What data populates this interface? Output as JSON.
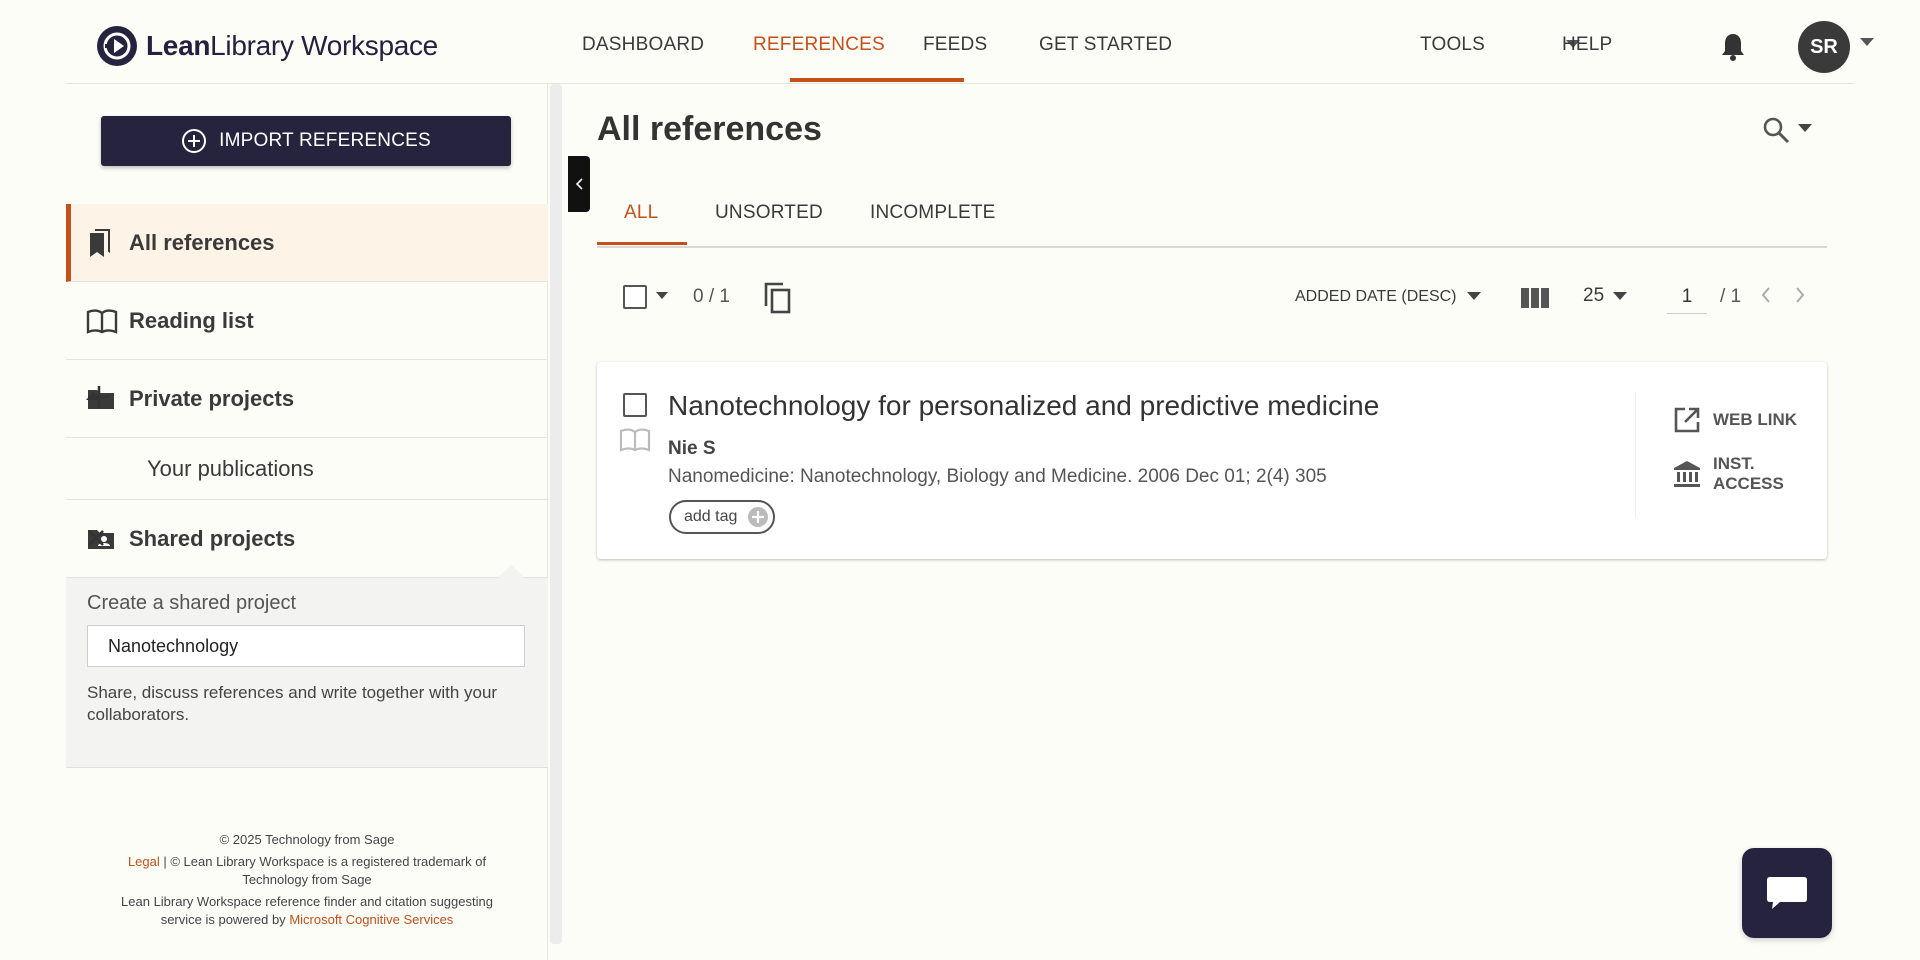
{
  "app": {
    "logo_bold": "Lean",
    "logo_rest": "Library Workspace",
    "brand_color": "#26233f",
    "accent_color": "#c4501a"
  },
  "nav": {
    "items": [
      {
        "label": "DASHBOARD",
        "active": false
      },
      {
        "label": "REFERENCES",
        "active": true
      },
      {
        "label": "FEEDS",
        "active": false
      },
      {
        "label": "GET STARTED",
        "active": false
      }
    ],
    "tools_label": "TOOLS",
    "help_label": "HELP",
    "avatar_initials": "SR"
  },
  "sidebar": {
    "import_label": "IMPORT REFERENCES",
    "all_references": "All references",
    "reading_list": "Reading list",
    "private_projects": "Private projects",
    "your_publications": "Your publications",
    "shared_projects": "Shared projects",
    "share_panel": {
      "title": "Create a shared project",
      "input_value": "Nanotechnology",
      "description": "Share, discuss references and write together with your collaborators."
    },
    "footer": {
      "copyright": "© 2025 Technology from Sage",
      "legal_link": "Legal",
      "trademark": " | © Lean Library Workspace is a registered trademark of Technology from Sage",
      "powered_prefix": "Lean Library Workspace reference finder and citation suggesting service is powered by ",
      "powered_link": "Microsoft Cognitive Services"
    }
  },
  "main": {
    "title": "All references",
    "tabs": [
      {
        "label": "ALL",
        "active": true
      },
      {
        "label": "UNSORTED",
        "active": false
      },
      {
        "label": "INCOMPLETE",
        "active": false
      }
    ],
    "toolbar": {
      "selected_count": "0 / 1",
      "sort_label": "ADDED DATE (DESC)",
      "per_page": "25",
      "page_value": "1",
      "page_total": "/ 1"
    },
    "references": [
      {
        "title": "Nanotechnology for personalized and predictive medicine",
        "author": "Nie S",
        "source": "Nanomedicine: Nanotechnology, Biology and Medicine. 2006 Dec 01; 2(4) 305",
        "tag_label": "add tag",
        "web_link_label": "WEB LINK",
        "inst_access_label": "INST. ACCESS"
      }
    ]
  },
  "icons": [
    "logo-mark-icon",
    "tools-caret-icon",
    "bell-icon",
    "avatar-caret-icon",
    "add-circle-icon",
    "bookmarks-icon",
    "book-open-icon",
    "folder-icon",
    "plus-icon",
    "collapse-up-icon",
    "shared-folder-icon",
    "close-icon",
    "collapse-sidebar-icon",
    "search-icon",
    "search-caret-icon",
    "checkbox-icon",
    "check-caret-icon",
    "copy-icon",
    "sort-caret-icon",
    "columns-icon",
    "per-page-caret-icon",
    "prev-page-icon",
    "next-page-icon",
    "book-icon",
    "add-tag-icon",
    "external-link-icon",
    "institution-icon",
    "chat-icon"
  ]
}
